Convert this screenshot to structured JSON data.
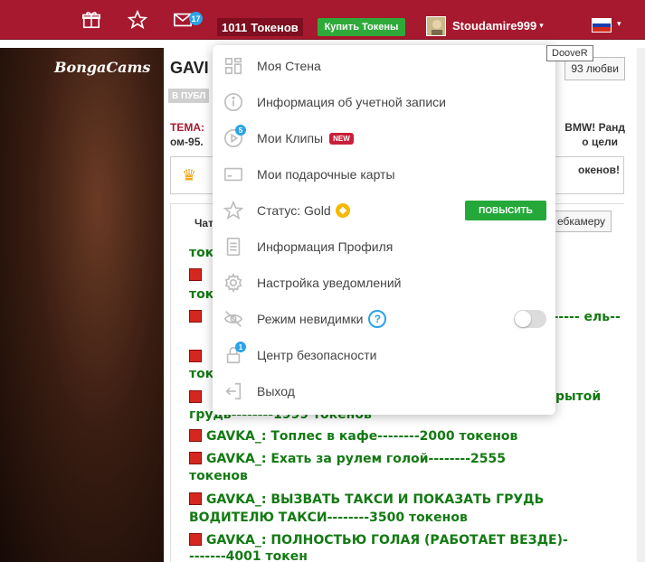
{
  "topbar": {
    "mail_count": "17",
    "tokens_value": "1011",
    "tokens_label": "Токенов",
    "buy_label": "Купить Токены",
    "username": "Stoudamire999",
    "caret": "▾"
  },
  "tooltip": "DooveR",
  "video": {
    "logo": "BongaCams"
  },
  "room": {
    "title": "GAVI",
    "love_label": "93 любви",
    "public_label": "В ПУБЛ",
    "theme_label": "ТЕМА:",
    "theme_line2": "ом-95.",
    "theme_right1": "BMW! Ранд",
    "theme_right2": "о цели",
    "promo_right": "окенов!",
    "chat_tab": "Чат",
    "webcam_label": "ебкамеру"
  },
  "chat": [
    "токен",
    "токен",
    "------- ель--",
    "токен",
    "рытой",
    "грудь--------1999 токенов",
    "GAVKA_: Топлес в кафе--------2000 токенов",
    "GAVKA_: Ехать за рулем голой--------2555",
    "токенов",
    "GAVKA_: ВЫЗВАТЬ ТАКСИ И ПОКАЗАТЬ ГРУДЬ",
    "ВОДИТЕЛЮ ТАКСИ--------3500 токенов",
    "GAVKA_: ПОЛНОСТЬЮ ГОЛАЯ (РАБОТАЕТ ВЕЗДЕ)-",
    "-------4001 токен"
  ],
  "menu": {
    "wall": "Моя Стена",
    "account_info": "Информация об учетной записи",
    "clips": "Мои Клипы",
    "clips_badge": "5",
    "clips_new": "NEW",
    "gift_cards": "Мои подарочные карты",
    "status_label": "Статус:",
    "status_value": "Gold",
    "upgrade_label": "ПОВЫСИТЬ",
    "profile_info": "Информация Профиля",
    "notifications": "Настройка уведомлений",
    "invisible": "Режим невидимки",
    "help_glyph": "?",
    "security": "Центр безопасности",
    "security_badge": "1",
    "logout": "Выход"
  },
  "colors": {
    "brand": "#a6192e",
    "buy_green": "#2faa3a",
    "chat_green": "#137a13",
    "badge_blue": "#2aa3e8",
    "new_badge": "#c81f3a",
    "gold": "#f6b800"
  },
  "icons": {
    "gift": "gift-icon",
    "star": "star-icon",
    "mail": "mail-icon",
    "wall": "grid-icon",
    "info": "info-icon",
    "play": "play-icon",
    "card": "card-icon",
    "status_star": "star-outline-icon",
    "profile": "document-icon",
    "settings": "gear-icon",
    "eye": "eye-off-icon",
    "lock": "lock-icon",
    "logout": "logout-icon"
  }
}
